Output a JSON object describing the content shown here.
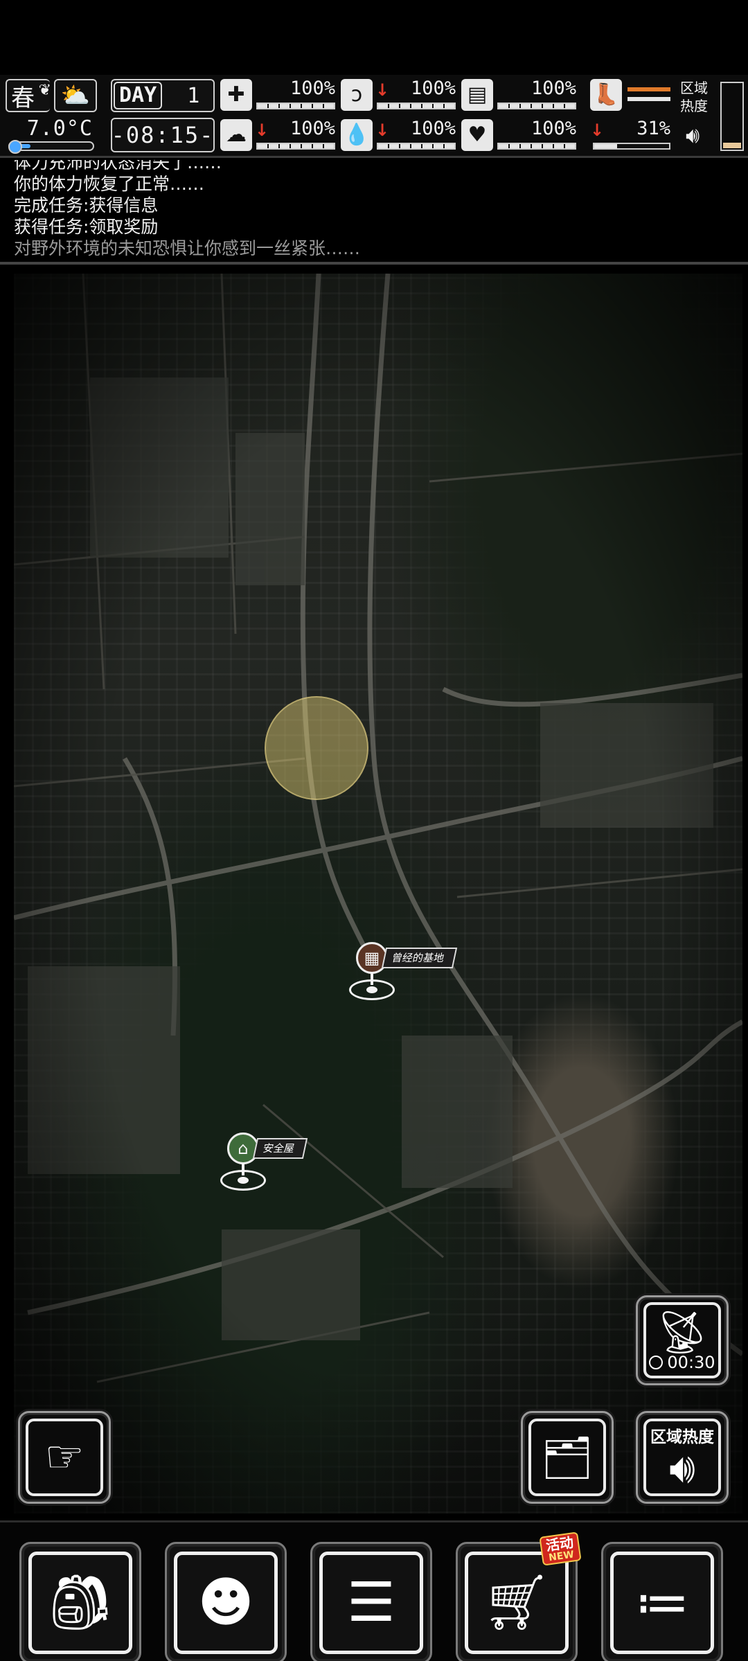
{
  "hud": {
    "season": "春",
    "weather_icon": "partly-cloudy-icon",
    "temperature": "7.0°C",
    "temperature_level": 0.18,
    "day_label": "DAY",
    "day_number": "1",
    "clock": "-08:15-",
    "stats": [
      {
        "name": "health",
        "icon": "medkit-icon",
        "value": "100%",
        "decreasing": false,
        "level": 1.0
      },
      {
        "name": "hunger",
        "icon": "stomach-icon",
        "value": "100%",
        "decreasing": true,
        "level": 1.0
      },
      {
        "name": "armor",
        "icon": "armor-icon",
        "value": "100%",
        "decreasing": false,
        "level": 1.0
      },
      {
        "name": "sanity",
        "icon": "brain-icon",
        "value": "100%",
        "decreasing": true,
        "level": 1.0
      },
      {
        "name": "thirst",
        "icon": "water-drop-icon",
        "value": "100%",
        "decreasing": true,
        "level": 1.0
      },
      {
        "name": "mood",
        "icon": "heart-icon",
        "value": "100%",
        "decreasing": false,
        "level": 1.0
      }
    ],
    "boot": {
      "icon": "boot-icon",
      "value": "31%",
      "decreasing": true,
      "level": 0.31
    },
    "region_heat": {
      "label_line1": "区域",
      "label_line2": "热度",
      "level": 0.08
    }
  },
  "log": {
    "partial_line": "体力充沛的状态消失了……",
    "lines": [
      "你的体力恢复了正常……",
      "完成任务:获得信息",
      "获得任务:领取奖励"
    ],
    "dim_line": "对野外环境的未知恐惧让你感到一丝紧张……"
  },
  "map": {
    "pois": [
      {
        "name": "former-base",
        "label": "曾经的基地",
        "icon": "building-icon",
        "color": "#5a3424"
      },
      {
        "name": "safe-house",
        "label": "安全屋",
        "icon": "house-icon",
        "color": "#3e6b3a"
      }
    ]
  },
  "buttons": {
    "radar_timer": "00:30",
    "region_heat_label": "区域热度"
  },
  "bottom_nav": {
    "items": [
      {
        "name": "backpack",
        "icon": "backpack-icon"
      },
      {
        "name": "skills",
        "icon": "brain-head-icon"
      },
      {
        "name": "journal",
        "icon": "notebook-icon"
      },
      {
        "name": "shop",
        "icon": "cart-icon",
        "badge": "活动",
        "badge_sub": "NEW"
      },
      {
        "name": "menu",
        "icon": "menu-list-icon"
      }
    ]
  }
}
